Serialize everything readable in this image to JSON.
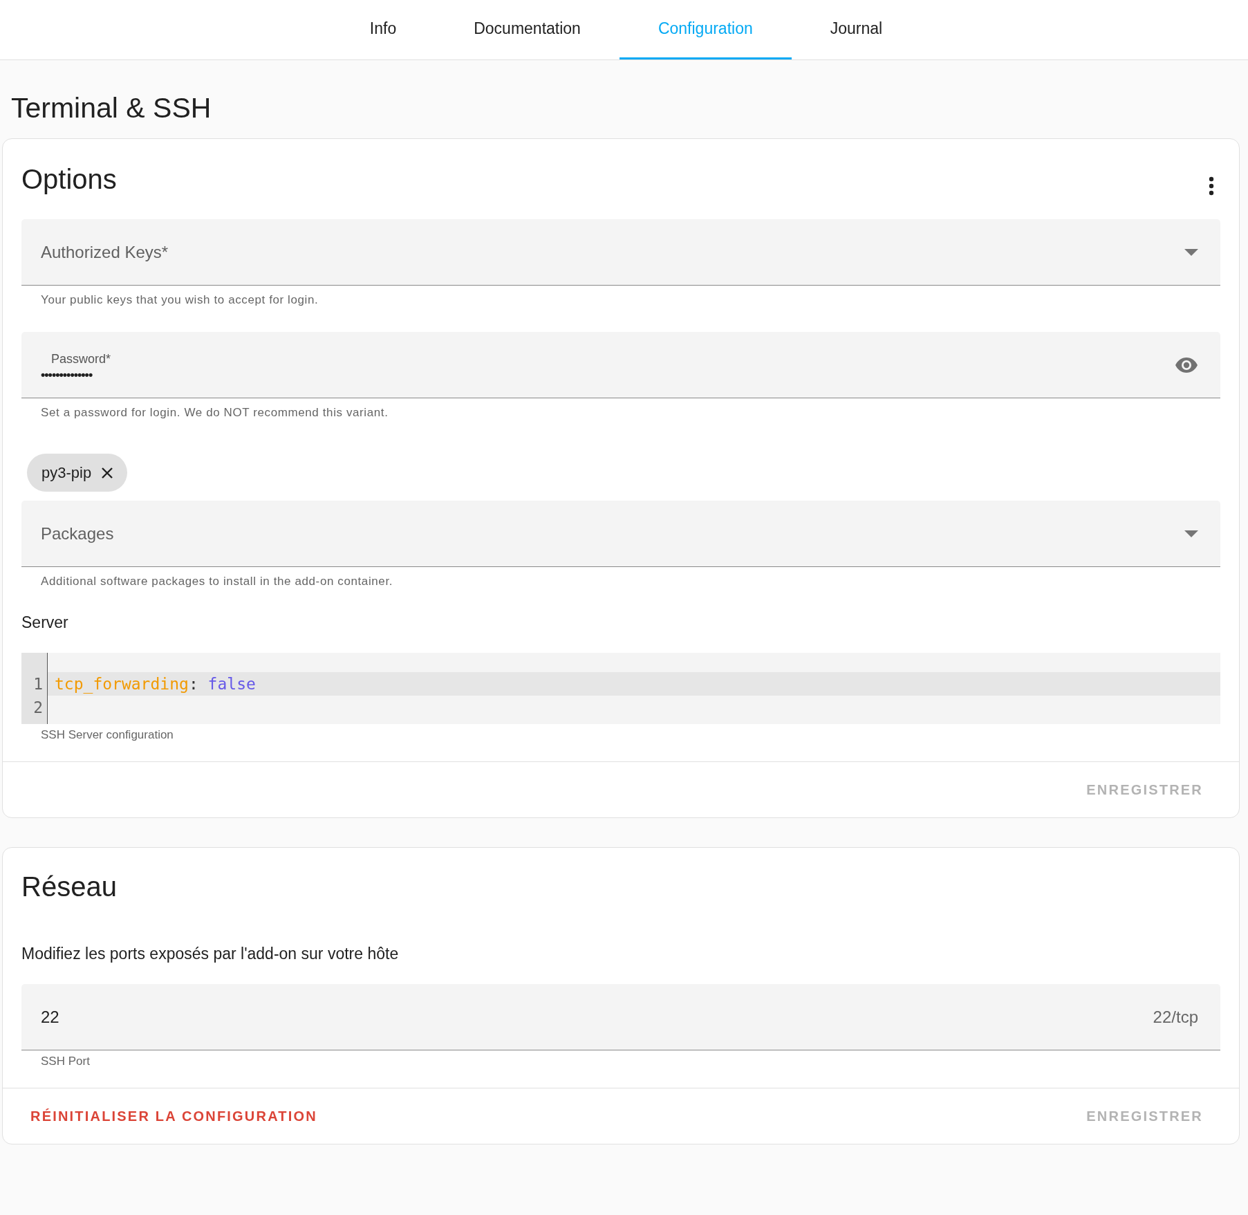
{
  "tabs": [
    {
      "label": "Info",
      "selected": false
    },
    {
      "label": "Documentation",
      "selected": false
    },
    {
      "label": "Configuration",
      "selected": true
    },
    {
      "label": "Journal",
      "selected": false
    }
  ],
  "page_title": "Terminal & SSH",
  "options_card": {
    "title": "Options",
    "fields": [
      {
        "kind": "select",
        "label": "Authorized Keys*",
        "helper": "Your public keys that you wish to accept for login."
      },
      {
        "kind": "password",
        "label": "Password*",
        "value": "••••••••••••••",
        "helper": "Set a password for login. We do NOT recommend this variant."
      },
      {
        "kind": "select",
        "label": "Packages",
        "chips": [
          "py3-pip"
        ],
        "helper": "Additional software packages to install in the add-on container."
      },
      {
        "kind": "code",
        "label": "Server",
        "lines": [
          {
            "number": "1",
            "key": "tcp_forwarding",
            "separator": ":",
            "value": "false",
            "highlighted": true
          },
          {
            "number": "2",
            "highlighted": false
          }
        ],
        "helper": "SSH Server configuration"
      }
    ],
    "save_button": {
      "label": "ENREGISTRER",
      "disabled": true
    }
  },
  "network_card": {
    "title": "Réseau",
    "description": "Modifiez les ports exposés par l'add-on sur votre hôte",
    "ports": [
      {
        "value": "22",
        "suffix": "22/tcp",
        "helper": "SSH Port"
      }
    ],
    "reset_button": {
      "label": "RÉINITIALISER LA CONFIGURATION"
    },
    "save_button": {
      "label": "ENREGISTRER",
      "disabled": true
    }
  }
}
